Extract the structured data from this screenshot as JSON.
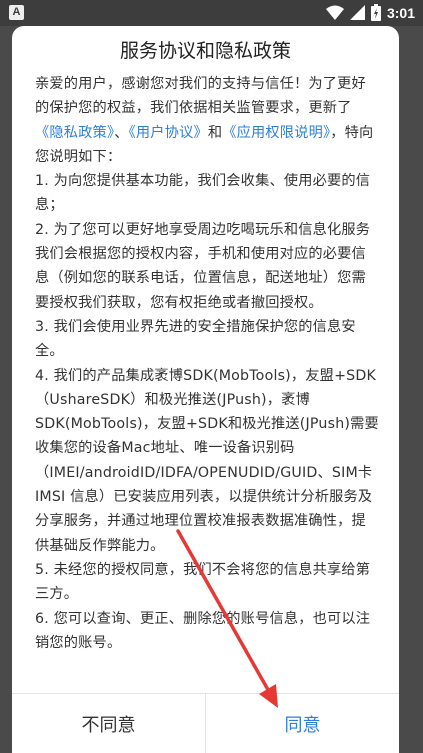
{
  "status_bar": {
    "notification_badge": "A",
    "time": "3:01",
    "icons": [
      "wifi-icon",
      "signal-icon",
      "battery-icon"
    ]
  },
  "dialog": {
    "title": "服务协议和隐私政策",
    "intro_1": "亲爱的用户，感谢您对我们的支持与信任！为了更好的保护您的权益，我们依据相关监管要求，更新了",
    "link_privacy": "《隐私政策》",
    "sep_1": "、",
    "link_user": "《用户协议》",
    "sep_2": "和",
    "link_app": "《应用权限说明》",
    "intro_2": "，特向您说明如下：",
    "items": [
      "1. 为向您提供基本功能，我们会收集、使用必要的信息；",
      "2. 为了您可以更好地享受周边吃喝玩乐和信息化服务我们会根据您的授权内容，手机和使用对应的必要信息（例如您的联系电话，位置信息，配送地址）您需要授权我们获取，您有权拒绝或者撤回授权。",
      "3. 我们会使用业界先进的安全措施保护您的信息安全。",
      "4. 我们的产品集成袤博SDK(MobTools)，友盟+SDK（UshareSDK）和极光推送(JPush)，袤博SDK(MobTools)，友盟+SDK和极光推送(JPush)需要收集您的设备Mac地址、唯一设备识别码（IMEI/androidID/IDFA/OPENUDID/GUID、SIM卡 IMSI 信息）已安装应用列表，以提供统计分析服务及分享服务，并通过地理位置校准报表数据准确性，提供基础反作弊能力。",
      "5. 未经您的授权同意，我们不会将您的信息共享给第三方。",
      "6. 您可以查询、更正、删除您的账号信息，也可以注销您的账号。"
    ],
    "disagree_label": "不同意",
    "agree_label": "同意"
  },
  "colors": {
    "link": "#2f7fd8",
    "agree": "#2f7fd8",
    "annotation_arrow": "#e53935",
    "status_bar": "#3d3d3d"
  }
}
